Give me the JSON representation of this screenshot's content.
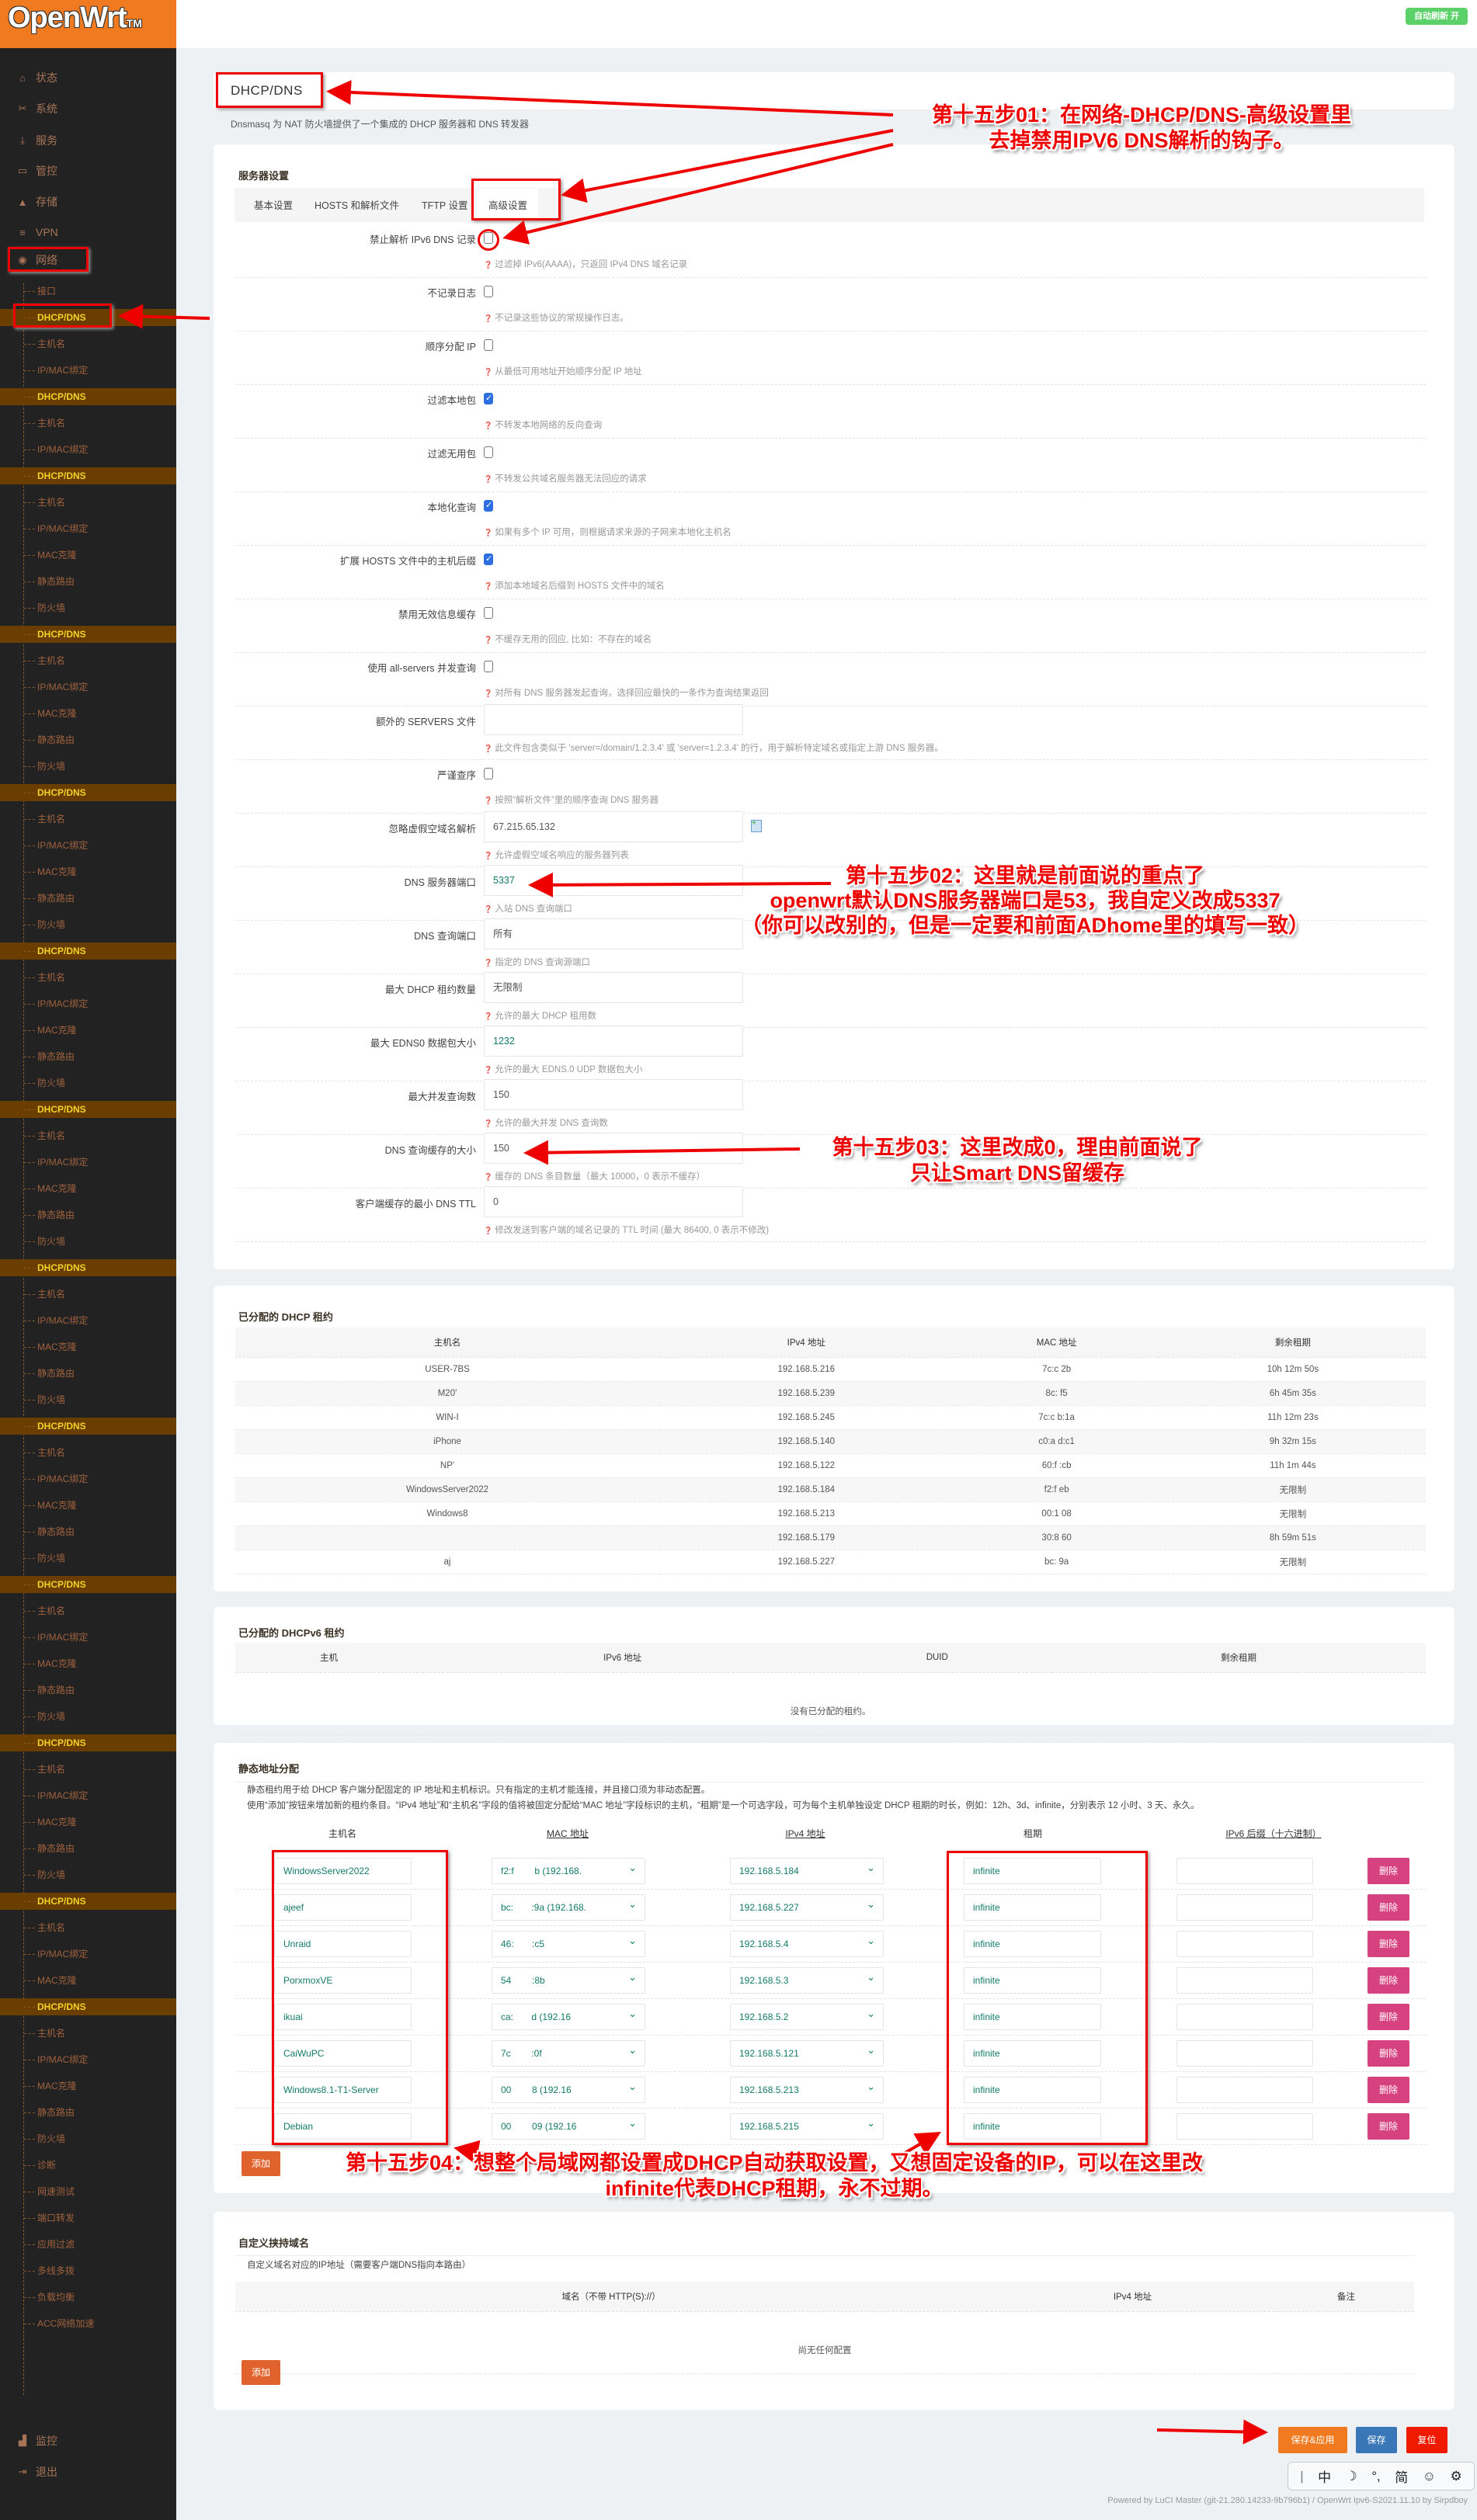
{
  "header": {
    "logo": "OpenWrt",
    "logo_tm": "TM",
    "auto_refresh": "自动刷新 开"
  },
  "sidebar": {
    "top": [
      {
        "label": "状态",
        "icon": "home-icon"
      },
      {
        "label": "系统",
        "icon": "tools-icon"
      },
      {
        "label": "服务",
        "icon": "download-icon"
      },
      {
        "label": "管控",
        "icon": "calendar-icon"
      },
      {
        "label": "存储",
        "icon": "disk-icon"
      },
      {
        "label": "VPN",
        "icon": "list-icon"
      },
      {
        "label": "网络",
        "icon": "globe-icon"
      }
    ],
    "sub": [
      {
        "label": "接口"
      },
      {
        "label": "DHCP/DNS",
        "active": true
      },
      {
        "label": "主机名"
      },
      {
        "label": "IP/MAC绑定"
      },
      {
        "label": "DHCP/DNS",
        "active": true
      },
      {
        "label": "主机名"
      },
      {
        "label": "IP/MAC绑定"
      },
      {
        "label": "DHCP/DNS",
        "active": true
      },
      {
        "label": "主机名"
      },
      {
        "label": "IP/MAC绑定"
      },
      {
        "label": "MAC克隆"
      },
      {
        "label": "静态路由"
      },
      {
        "label": "防火墙"
      },
      {
        "label": "DHCP/DNS",
        "active": true
      },
      {
        "label": "主机名"
      },
      {
        "label": "IP/MAC绑定"
      },
      {
        "label": "MAC克隆"
      },
      {
        "label": "静态路由"
      },
      {
        "label": "防火墙"
      },
      {
        "label": "DHCP/DNS",
        "active": true
      },
      {
        "label": "主机名"
      },
      {
        "label": "IP/MAC绑定"
      },
      {
        "label": "MAC克隆"
      },
      {
        "label": "静态路由"
      },
      {
        "label": "防火墙"
      },
      {
        "label": "DHCP/DNS",
        "active": true
      },
      {
        "label": "主机名"
      },
      {
        "label": "IP/MAC绑定"
      },
      {
        "label": "MAC克隆"
      },
      {
        "label": "静态路由"
      },
      {
        "label": "防火墙"
      },
      {
        "label": "DHCP/DNS",
        "active": true
      },
      {
        "label": "主机名"
      },
      {
        "label": "IP/MAC绑定"
      },
      {
        "label": "MAC克隆"
      },
      {
        "label": "静态路由"
      },
      {
        "label": "防火墙"
      },
      {
        "label": "DHCP/DNS",
        "active": true
      },
      {
        "label": "主机名"
      },
      {
        "label": "IP/MAC绑定"
      },
      {
        "label": "MAC克隆"
      },
      {
        "label": "静态路由"
      },
      {
        "label": "防火墙"
      },
      {
        "label": "DHCP/DNS",
        "active": true
      },
      {
        "label": "主机名"
      },
      {
        "label": "IP/MAC绑定"
      },
      {
        "label": "MAC克隆"
      },
      {
        "label": "静态路由"
      },
      {
        "label": "防火墙"
      },
      {
        "label": "DHCP/DNS",
        "active": true
      },
      {
        "label": "主机名"
      },
      {
        "label": "IP/MAC绑定"
      },
      {
        "label": "MAC克隆"
      },
      {
        "label": "静态路由"
      },
      {
        "label": "防火墙"
      },
      {
        "label": "DHCP/DNS",
        "active": true
      },
      {
        "label": "主机名"
      },
      {
        "label": "IP/MAC绑定"
      },
      {
        "label": "MAC克隆"
      },
      {
        "label": "静态路由"
      },
      {
        "label": "防火墙"
      },
      {
        "label": "DHCP/DNS",
        "active": true
      },
      {
        "label": "主机名"
      },
      {
        "label": "IP/MAC绑定"
      },
      {
        "label": "MAC克隆"
      },
      {
        "label": "DHCP/DNS",
        "active": true
      },
      {
        "label": "主机名"
      },
      {
        "label": "IP/MAC绑定"
      },
      {
        "label": "MAC克隆"
      },
      {
        "label": "静态路由"
      },
      {
        "label": "防火墙"
      },
      {
        "label": "诊断"
      },
      {
        "label": "网速测试"
      },
      {
        "label": "端口转发"
      },
      {
        "label": "应用过滤"
      },
      {
        "label": "多线多拨"
      },
      {
        "label": "负载均衡"
      },
      {
        "label": "ACC网络加速"
      }
    ],
    "bottom": [
      {
        "label": "监控",
        "icon": "chart-icon"
      },
      {
        "label": "退出",
        "icon": "logout-icon"
      }
    ]
  },
  "page": {
    "title": "DHCP/DNS",
    "description": "Dnsmasq 为 NAT 防火墙提供了一个集成的 DHCP 服务器和 DNS 转发器"
  },
  "server_settings": {
    "title": "服务器设置",
    "tabs": [
      {
        "label": "基本设置"
      },
      {
        "label": "HOSTS 和解析文件"
      },
      {
        "label": "TFTP 设置"
      },
      {
        "label": "高级设置",
        "active": true
      }
    ],
    "rows": [
      {
        "label": "禁止解析 IPv6 DNS 记录",
        "type": "checkbox",
        "checked": false,
        "help": "过滤掉 IPv6(AAAA)，只返回 IPv4 DNS 域名记录"
      },
      {
        "label": "不记录日志",
        "type": "checkbox",
        "checked": false,
        "help": "不记录这些协议的常规操作日志。"
      },
      {
        "label": "顺序分配 IP",
        "type": "checkbox",
        "checked": false,
        "help": "从最低可用地址开始顺序分配 IP 地址"
      },
      {
        "label": "过滤本地包",
        "type": "checkbox",
        "checked": true,
        "help": "不转发本地网络的反向查询"
      },
      {
        "label": "过滤无用包",
        "type": "checkbox",
        "checked": false,
        "help": "不转发公共域名服务器无法回应的请求"
      },
      {
        "label": "本地化查询",
        "type": "checkbox",
        "checked": true,
        "help": "如果有多个 IP 可用，则根据请求来源的子网来本地化主机名"
      },
      {
        "label": "扩展 HOSTS 文件中的主机后缀",
        "type": "checkbox",
        "checked": true,
        "help": "添加本地域名后缀到 HOSTS 文件中的域名"
      },
      {
        "label": "禁用无效信息缓存",
        "type": "checkbox",
        "checked": false,
        "help": "不缓存无用的回应, 比如：不存在的域名"
      },
      {
        "label": "使用 all-servers 并发查询",
        "type": "checkbox",
        "checked": false,
        "help": "对所有 DNS 服务器发起查询，选择回应最快的一条作为查询结果返回"
      },
      {
        "label": "额外的 SERVERS 文件",
        "type": "input",
        "value": "",
        "help": "此文件包含类似于 'server=/domain/1.2.3.4' 或 'server=1.2.3.4' 的行，用于解析特定域名或指定上游 DNS 服务器。"
      },
      {
        "label": "严谨查序",
        "type": "checkbox",
        "checked": false,
        "help": "按照“解析文件”里的顺序查询 DNS 服务器"
      },
      {
        "label": "忽略虚假空域名解析",
        "type": "input",
        "value": "67.215.65.132",
        "help": "允许虚假空域名响应的服务器列表",
        "add_icon": true
      },
      {
        "label": "DNS 服务器端口",
        "type": "input",
        "value": "5337",
        "teal": true,
        "help": "入站 DNS 查询端口"
      },
      {
        "label": "DNS 查询端口",
        "type": "input",
        "value": "所有",
        "help": "指定的 DNS 查询源端口"
      },
      {
        "label": "最大 DHCP 租约数量",
        "type": "input",
        "value": "无限制",
        "help": "允许的最大 DHCP 租用数"
      },
      {
        "label": "最大 EDNS0 数据包大小",
        "type": "input",
        "value": "1232",
        "teal": true,
        "help": "允许的最大 EDNS.0 UDP 数据包大小"
      },
      {
        "label": "最大并发查询数",
        "type": "input",
        "value": "150",
        "help": "允许的最大并发 DNS 查询数"
      },
      {
        "label": "DNS 查询缓存的大小",
        "type": "input",
        "value": "150",
        "help": "缓存的 DNS 条目数量（最大 10000，0 表示不缓存）"
      },
      {
        "label": "客户端缓存的最小 DNS TTL",
        "type": "input",
        "value": "0",
        "help": "修改发送到客户端的域名记录的 TTL 时间 (最大 86400, 0 表示不修改)"
      }
    ]
  },
  "leases": {
    "title": "已分配的 DHCP 租约",
    "columns": [
      "主机名",
      "IPv4 地址",
      "MAC 地址",
      "剩余租期"
    ],
    "rows": [
      [
        "USER-7BS",
        "192.168.5.216",
        "7c:c       2b",
        "10h 12m 50s"
      ],
      [
        "M20'",
        "192.168.5.239",
        "8c:       f5",
        "6h 45m 35s"
      ],
      [
        "WIN-I",
        "192.168.5.245",
        "7c:c      b:1a",
        "11h 12m 23s"
      ],
      [
        "iPhone",
        "192.168.5.140",
        "c0:a      d:c1",
        "9h 32m 15s"
      ],
      [
        "NP'",
        "192.168.5.122",
        "60:f      :cb",
        "11h 1m 44s"
      ],
      [
        "WindowsServer2022",
        "192.168.5.184",
        "f2:f      eb",
        "无限制"
      ],
      [
        "Windows8",
        "192.168.5.213",
        "00:1      08",
        "无限制"
      ],
      [
        "",
        "192.168.5.179",
        "30:8      60",
        "8h 59m 51s"
      ],
      [
        "aj",
        "192.168.5.227",
        "bc:      9a",
        "无限制"
      ]
    ]
  },
  "leases6": {
    "title": "已分配的 DHCPv6 租约",
    "columns": [
      "主机",
      "IPv6 地址",
      "DUID",
      "剩余租期"
    ],
    "empty": "没有已分配的租约。"
  },
  "static": {
    "title": "静态地址分配",
    "desc1": "静态租约用于给 DHCP 客户端分配固定的 IP 地址和主机标识。只有指定的主机才能连接，并且接口须为非动态配置。",
    "desc2": "使用“添加”按钮来增加新的租约条目。“IPv4 地址”和“主机名”字段的值将被固定分配给“MAC 地址”字段标识的主机，“租期”是一个可选字段，可为每个主机单独设定 DHCP 租期的时长，例如：12h、3d、infinite，分别表示 12 小时、3 天、永久。",
    "columns": [
      "主机名",
      "MAC 地址",
      "IPv4 地址",
      "租期",
      "IPv6 后缀（十六进制）"
    ],
    "rows": [
      {
        "host": "WindowsServer2022",
        "mac": "f2:f        b (192.168.",
        "ip": "192.168.5.184",
        "lease": "infinite",
        "ipv6": ""
      },
      {
        "host": "ajeef",
        "mac": "bc:       :9a (192.168.",
        "ip": "192.168.5.227",
        "lease": "infinite",
        "ipv6": ""
      },
      {
        "host": "Unraid",
        "mac": "46:       :c5",
        "ip": "192.168.5.4",
        "lease": "infinite",
        "ipv6": ""
      },
      {
        "host": "PorxmoxVE",
        "mac": "54        :8b",
        "ip": "192.168.5.3",
        "lease": "infinite",
        "ipv6": ""
      },
      {
        "host": "ikuai",
        "mac": "ca:       d (192.16",
        "ip": "192.168.5.2",
        "lease": "infinite",
        "ipv6": ""
      },
      {
        "host": "CaiWuPC",
        "mac": "7c        :0f",
        "ip": "192.168.5.121",
        "lease": "infinite",
        "ipv6": ""
      },
      {
        "host": "Windows8.1-T1-Server",
        "mac": "00        8 (192.16",
        "ip": "192.168.5.213",
        "lease": "infinite",
        "ipv6": ""
      },
      {
        "host": "Debian",
        "mac": "00        09 (192.16",
        "ip": "192.168.5.215",
        "lease": "infinite",
        "ipv6": ""
      }
    ],
    "delete_label": "删除",
    "add_label": "添加"
  },
  "custom_domain": {
    "title": "自定义挟持域名",
    "desc": "自定义域名对应的IP地址（需要客户端DNS指向本路由）",
    "columns": [
      "域名（不带 HTTP(S)://）",
      "IPv4 地址",
      "备注"
    ],
    "empty": "尚无任何配置",
    "add_label": "添加"
  },
  "actions": {
    "save_apply": "保存&应用",
    "save": "保存",
    "reset": "复位",
    "colors": {
      "save_apply": "#f07a20",
      "save": "#3a77b8",
      "reset": "#f01a00"
    }
  },
  "ime": {
    "items": [
      "中",
      "☽",
      "°,",
      "简",
      "☺",
      "⚙"
    ]
  },
  "footer": "Powered by LuCI Master (git-21.280.14233-9b796b1) / OpenWrt Ipv6-S2021.11.10 by Sirpdboy",
  "annotations": {
    "step01": [
      "第十五步01：在网络-DHCP/DNS-高级设置里",
      "去掉禁用IPV6 DNS解析的钩子。"
    ],
    "step02": [
      "第十五步02：这里就是前面说的重点了",
      "openwrt默认DNS服务器端口是53，我自定义改成5337",
      "（你可以改别的，但是一定要和前面ADhome里的填写一致）"
    ],
    "step03": [
      "第十五步03：这里改成0，理由前面说了",
      "只让Smart DNS留缓存"
    ],
    "step04": [
      "第十五步04：想整个局域网都设置成DHCP自动获取设置，又想固定设备的IP，可以在这里改",
      "infinite代表DHCP租期，永不过期。"
    ]
  }
}
